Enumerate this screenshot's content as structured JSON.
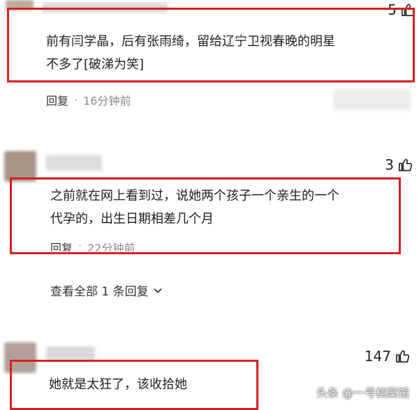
{
  "comments": [
    {
      "text_line1": "前有闫学晶，后有张雨绮，留给辽宁卫视春晚的明星",
      "text_line2": "不多了[破涕为笑]",
      "reply_label": "回复",
      "time": "16分钟前",
      "likes": "5"
    },
    {
      "text_line1": "之前就在网上看到过，说她两个孩子一个亲生的一个",
      "text_line2": "代孕的，出生日期相差几个月",
      "reply_label": "回复",
      "time": "22分钟前",
      "likes": "3",
      "view_all": "查看全部 1 条回复"
    },
    {
      "text_line1": "她就是太狂了，该收拾她",
      "likes": "147"
    }
  ],
  "watermark": "头条 @一号档案馆",
  "colors": {
    "highlight_box": "#d42020",
    "thumb": "#222222"
  }
}
